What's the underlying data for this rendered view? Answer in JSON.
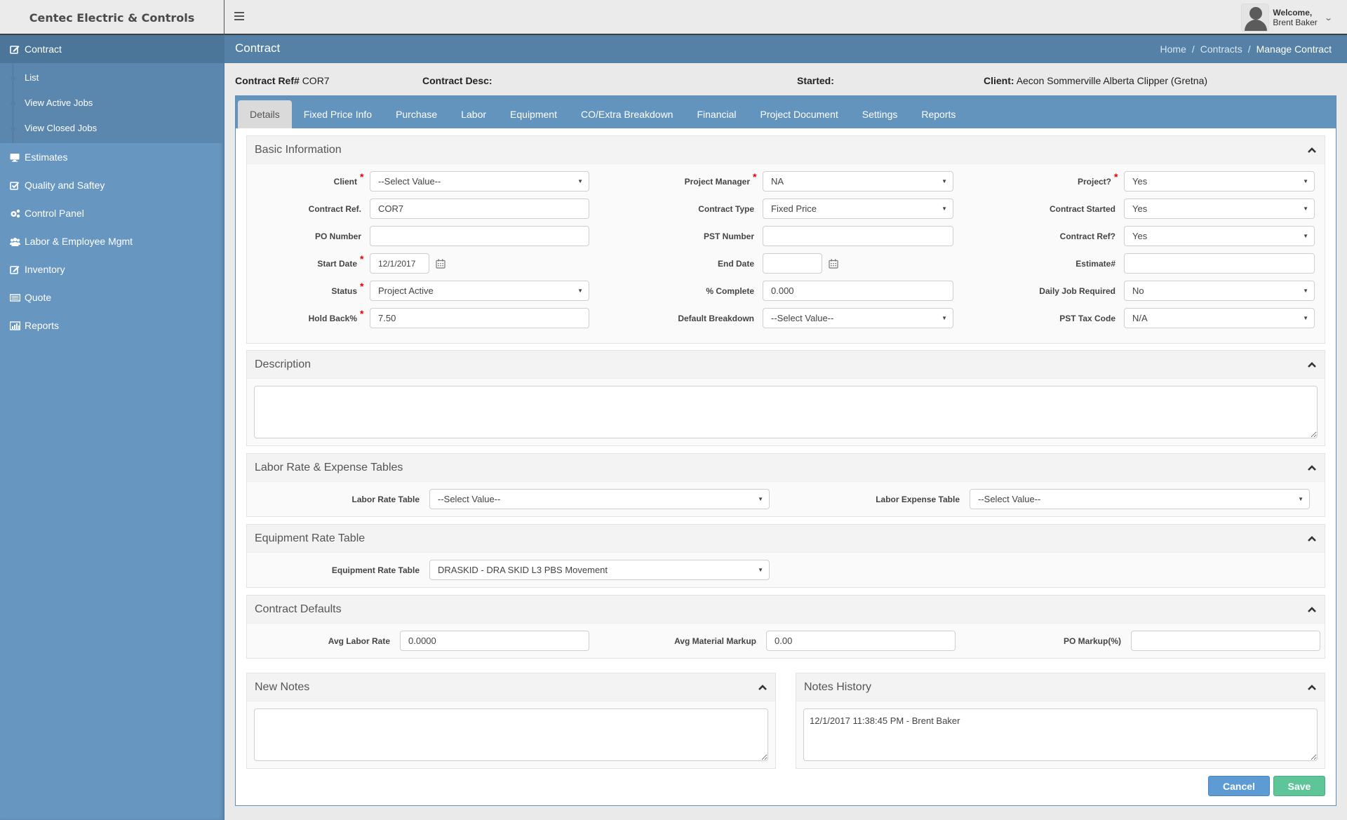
{
  "app": {
    "brand": "Centec Electric & Controls",
    "menu_icon": "hamburger-icon"
  },
  "user": {
    "welcome": "Welcome,",
    "name": "Brent Baker",
    "avatar_icon": "user-avatar-icon",
    "dropdown_icon": "chevron-down-icon"
  },
  "sidebar": {
    "active": {
      "label": "Contract",
      "icon": "edit-icon"
    },
    "submenu": [
      {
        "label": "List"
      },
      {
        "label": "View Active Jobs"
      },
      {
        "label": "View Closed Jobs"
      }
    ],
    "items": [
      {
        "label": "Estimates",
        "icon": "monitor-icon"
      },
      {
        "label": "Quality and Saftey",
        "icon": "checkbox-icon"
      },
      {
        "label": "Control Panel",
        "icon": "gears-icon"
      },
      {
        "label": "Labor & Employee Mgmt",
        "icon": "users-icon"
      },
      {
        "label": "Inventory",
        "icon": "edit-icon"
      },
      {
        "label": "Quote",
        "icon": "keyboard-icon"
      },
      {
        "label": "Reports",
        "icon": "bar-chart-icon"
      }
    ]
  },
  "header": {
    "title": "Contract",
    "breadcrumb": [
      "Home",
      "Contracts",
      "Manage Contract"
    ],
    "separator": "/"
  },
  "info": {
    "contract_ref_label": "Contract Ref#",
    "contract_ref_value": "COR7",
    "contract_desc_label": "Contract Desc:",
    "contract_desc_value": "",
    "started_label": "Started:",
    "started_value": "",
    "client_label": "Client:",
    "client_value": "Aecon Sommerville Alberta Clipper (Gretna)"
  },
  "tabs": [
    {
      "label": "Details",
      "active": true
    },
    {
      "label": "Fixed Price Info"
    },
    {
      "label": "Purchase"
    },
    {
      "label": "Labor"
    },
    {
      "label": "Equipment"
    },
    {
      "label": "CO/Extra Breakdown"
    },
    {
      "label": "Financial"
    },
    {
      "label": "Project Document"
    },
    {
      "label": "Settings"
    },
    {
      "label": "Reports"
    }
  ],
  "basic": {
    "title": "Basic Information",
    "col1": [
      {
        "label": "Client",
        "value": "--Select Value--",
        "type": "select",
        "required": true
      },
      {
        "label": "Contract Ref.",
        "value": "COR7",
        "type": "text"
      },
      {
        "label": "PO Number",
        "value": "",
        "type": "text"
      },
      {
        "label": "Start Date",
        "value": "12/1/2017",
        "type": "date",
        "required": true
      },
      {
        "label": "Status",
        "value": "Project Active",
        "type": "select",
        "required": true
      },
      {
        "label": "Hold Back%",
        "value": "7.50",
        "type": "text",
        "required": true
      }
    ],
    "col2": [
      {
        "label": "Project Manager",
        "value": "NA",
        "type": "select",
        "required": true
      },
      {
        "label": "Contract Type",
        "value": "Fixed Price",
        "type": "select"
      },
      {
        "label": "PST Number",
        "value": "",
        "type": "text"
      },
      {
        "label": "End Date",
        "value": "",
        "type": "date"
      },
      {
        "label": "% Complete",
        "value": "0.000",
        "type": "text"
      },
      {
        "label": "Default Breakdown",
        "value": "--Select Value--",
        "type": "select"
      }
    ],
    "col3": [
      {
        "label": "Project?",
        "value": "Yes",
        "type": "select",
        "required": true
      },
      {
        "label": "Contract Started",
        "value": "Yes",
        "type": "select"
      },
      {
        "label": "Contract Ref?",
        "value": "Yes",
        "type": "select"
      },
      {
        "label": "Estimate#",
        "value": "",
        "type": "text"
      },
      {
        "label": "Daily Job Required",
        "value": "No",
        "type": "select"
      },
      {
        "label": "PST Tax Code",
        "value": "N/A",
        "type": "select"
      }
    ]
  },
  "description": {
    "title": "Description",
    "value": ""
  },
  "labor_tables": {
    "title": "Labor Rate & Expense Tables",
    "labor_rate_label": "Labor Rate Table",
    "labor_rate_value": "--Select Value--",
    "labor_expense_label": "Labor Expense Table",
    "labor_expense_value": "--Select Value--"
  },
  "equipment": {
    "title": "Equipment Rate Table",
    "label": "Equipment Rate Table",
    "value": "DRASKID - DRA SKID L3 PBS Movement"
  },
  "defaults": {
    "title": "Contract Defaults",
    "avg_labor_label": "Avg Labor Rate",
    "avg_labor_value": "0.0000",
    "avg_material_label": "Avg Material Markup",
    "avg_material_value": "0.00",
    "po_markup_label": "PO Markup(%)",
    "po_markup_value": ""
  },
  "new_notes": {
    "title": "New Notes",
    "value": ""
  },
  "notes_history": {
    "title": "Notes History",
    "value": "12/1/2017 11:38:45 PM - Brent Baker"
  },
  "actions": {
    "cancel": "Cancel",
    "save": "Save"
  },
  "colors": {
    "sidebar": "#6796c0",
    "sidebar_active": "#4b7599",
    "titlebar": "#5581a7",
    "tabbar": "#6394be",
    "cancel": "#5d9bd4",
    "save": "#5ec598",
    "required": "#ee0000"
  }
}
